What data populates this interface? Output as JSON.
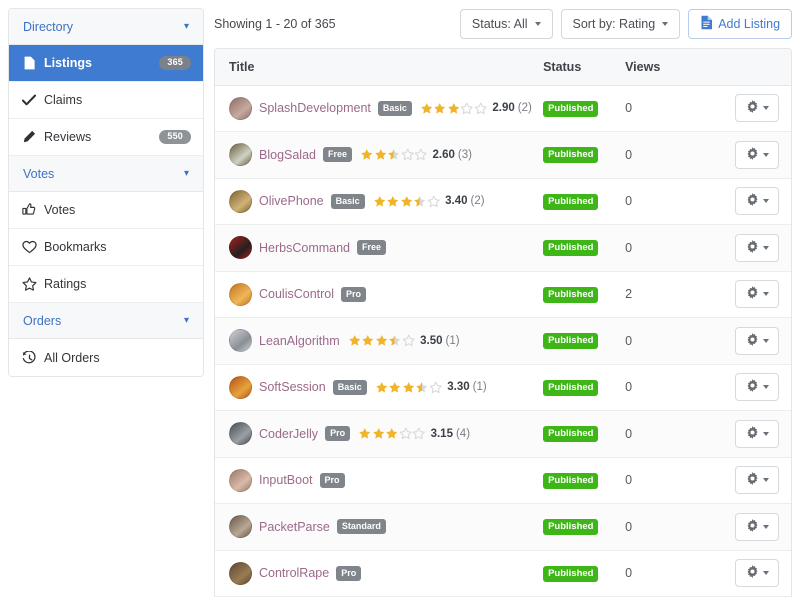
{
  "sidebar": {
    "groups": [
      {
        "label": "Directory",
        "icon": "chevron-down-icon",
        "items": [
          {
            "label": "Listings",
            "icon": "file-icon",
            "badge": "365",
            "active": true
          },
          {
            "label": "Claims",
            "icon": "check-icon",
            "badge": "",
            "active": false
          },
          {
            "label": "Reviews",
            "icon": "pencil-icon",
            "badge": "550",
            "active": false
          }
        ]
      },
      {
        "label": "Votes",
        "icon": "chevron-down-icon",
        "items": [
          {
            "label": "Votes",
            "icon": "thumbs-up-icon",
            "badge": "",
            "active": false
          },
          {
            "label": "Bookmarks",
            "icon": "heart-icon",
            "badge": "",
            "active": false
          },
          {
            "label": "Ratings",
            "icon": "star-outline-icon",
            "badge": "",
            "active": false
          }
        ]
      },
      {
        "label": "Orders",
        "icon": "chevron-down-icon",
        "items": [
          {
            "label": "All Orders",
            "icon": "history-icon",
            "badge": "",
            "active": false
          }
        ]
      }
    ]
  },
  "toolbar": {
    "showing": "Showing 1 - 20 of 365",
    "status_filter": "Status: All",
    "sort_by": "Sort by: Rating",
    "add_listing": "Add Listing",
    "add_listing_icon": "file-icon"
  },
  "table": {
    "columns": {
      "title": "Title",
      "status": "Status",
      "views": "Views",
      "actions": ""
    },
    "action_icon": "gear-icon",
    "rows": [
      {
        "name": "SplashDevelopment",
        "plan": "Basic",
        "rating": "2.90",
        "count": "(2)",
        "stars": 3.0,
        "status": "Published",
        "views": "0",
        "avatar": "#8d6f6a,#c8a9a0"
      },
      {
        "name": "BlogSalad",
        "plan": "Free",
        "rating": "2.60",
        "count": "(3)",
        "stars": 2.5,
        "status": "Published",
        "views": "0",
        "avatar": "#6d5f45,#cfd3c2"
      },
      {
        "name": "OlivePhone",
        "plan": "Basic",
        "rating": "3.40",
        "count": "(2)",
        "stars": 3.5,
        "status": "Published",
        "views": "0",
        "avatar": "#7d6436,#d2b277"
      },
      {
        "name": "HerbsCommand",
        "plan": "Free",
        "rating": "",
        "count": "",
        "stars": 0,
        "status": "Published",
        "views": "0",
        "avatar": "#a81f1f,#23211f"
      },
      {
        "name": "CoulisControl",
        "plan": "Pro",
        "rating": "",
        "count": "",
        "stars": 0,
        "status": "Published",
        "views": "2",
        "avatar": "#c4761d,#f0b65a"
      },
      {
        "name": "LeanAlgorithm",
        "plan": "",
        "rating": "3.50",
        "count": "(1)",
        "stars": 3.5,
        "status": "Published",
        "views": "0",
        "avatar": "#cfd2d6,#8a8f96"
      },
      {
        "name": "SoftSession",
        "plan": "Basic",
        "rating": "3.30",
        "count": "(1)",
        "stars": 3.5,
        "status": "Published",
        "views": "0",
        "avatar": "#b4541a,#e8a33c"
      },
      {
        "name": "CoderJelly",
        "plan": "Pro",
        "rating": "3.15",
        "count": "(4)",
        "stars": 3.0,
        "status": "Published",
        "views": "0",
        "avatar": "#4b4e52,#9aa0a6"
      },
      {
        "name": "InputBoot",
        "plan": "Pro",
        "rating": "",
        "count": "",
        "stars": 0,
        "status": "Published",
        "views": "0",
        "avatar": "#9b7868,#d9bba9"
      },
      {
        "name": "PacketParse",
        "plan": "Standard",
        "rating": "",
        "count": "",
        "stars": 0,
        "status": "Published",
        "views": "0",
        "avatar": "#6a584a,#b9a894"
      },
      {
        "name": "ControlRape",
        "plan": "Pro",
        "rating": "",
        "count": "",
        "stars": 0,
        "status": "Published",
        "views": "0",
        "avatar": "#5d4a35,#9a7b52"
      }
    ]
  },
  "colors": {
    "accent": "#3f7bd0",
    "status_published": "#3fb618",
    "star": "#f0b429",
    "star_empty": "#d7dadd",
    "title_link": "#9b6a8a",
    "plan_badge": "#7f858b"
  }
}
